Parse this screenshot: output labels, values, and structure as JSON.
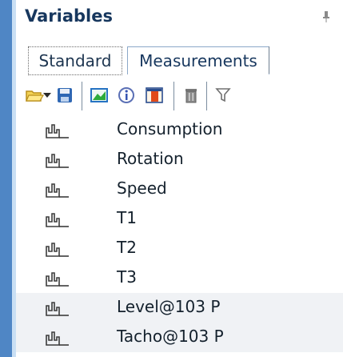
{
  "panel": {
    "title": "Variables",
    "tabs": [
      {
        "label": "Standard",
        "active": true
      },
      {
        "label": "Measurements",
        "active": false
      }
    ],
    "toolbar": [
      {
        "name": "open-folder-icon"
      },
      {
        "name": "dropdown-arrow-icon"
      },
      {
        "name": "save-icon"
      },
      {
        "name": "chart-image-icon"
      },
      {
        "name": "info-icon"
      },
      {
        "name": "table-icon"
      },
      {
        "name": "trash-icon"
      },
      {
        "name": "filter-icon"
      }
    ],
    "variables": [
      {
        "name": "Consumption",
        "highlighted": false
      },
      {
        "name": "Rotation",
        "highlighted": false
      },
      {
        "name": "Speed",
        "highlighted": false
      },
      {
        "name": "T1",
        "highlighted": false
      },
      {
        "name": "T2",
        "highlighted": false
      },
      {
        "name": "T3",
        "highlighted": false
      },
      {
        "name": "Level@103 P",
        "highlighted": true
      },
      {
        "name": "Tacho@103 P",
        "highlighted": true
      }
    ]
  }
}
